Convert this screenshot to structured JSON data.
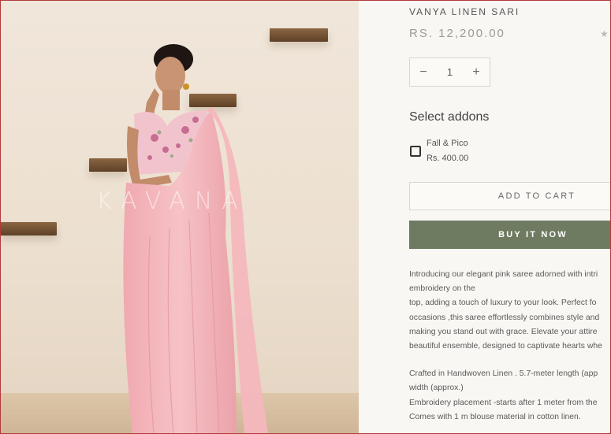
{
  "product": {
    "watermark": "KAVANA",
    "title": "VANYA LINEN SARI",
    "price": "RS. 12,200.00",
    "rating_icon": "star-icon",
    "quantity": "1",
    "decrement_symbol": "−",
    "increment_symbol": "+"
  },
  "addons": {
    "heading": "Select addons",
    "items": [
      {
        "name": "Fall & Pico",
        "price": "Rs. 400.00",
        "checked": false
      }
    ]
  },
  "actions": {
    "add_to_cart": "ADD TO CART",
    "buy_now": "BUY IT NOW"
  },
  "description": {
    "lines": [
      "Introducing our elegant pink saree adorned with intri",
      "embroidery on the",
      "top, adding a touch of luxury to your look. Perfect fo",
      "occasions ,this saree effortlessly combines style and",
      "making you stand out with grace. Elevate your attire",
      "beautiful ensemble, designed to captivate hearts whe"
    ],
    "details": [
      "Crafted in Handwoven Linen . 5.7-meter length (app",
      "width (approx.)",
      "Embroidery placement -starts after 1 meter from the",
      "Comes with 1 m blouse material in cotton linen."
    ]
  },
  "colors": {
    "buy_button": "#6e7b60",
    "saree_pink": "#f2b3b9",
    "background": "#f9f7f3"
  }
}
